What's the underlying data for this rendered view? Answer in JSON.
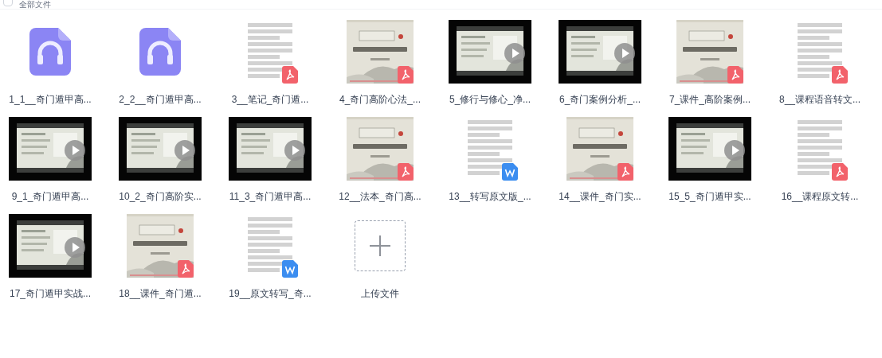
{
  "header": {
    "title": "全部文件",
    "checked": false
  },
  "files": [
    {
      "name": "1_1__奇门遁甲高...",
      "kind": "audio"
    },
    {
      "name": "2_2__奇门遁甲高...",
      "kind": "audio"
    },
    {
      "name": "3__笔记_奇门遁...",
      "kind": "pdf-page"
    },
    {
      "name": "4_奇门高阶心法_...",
      "kind": "pdf-slide"
    },
    {
      "name": "5_修行与修心_净...",
      "kind": "video"
    },
    {
      "name": "6_奇门案例分析_...",
      "kind": "video"
    },
    {
      "name": "7_课件_高阶案例...",
      "kind": "pdf-slide"
    },
    {
      "name": "8__课程语音转文...",
      "kind": "pdf-page"
    },
    {
      "name": "9_1_奇门遁甲高...",
      "kind": "video"
    },
    {
      "name": "10_2_奇门高阶实...",
      "kind": "video"
    },
    {
      "name": "11_3_奇门遁甲高...",
      "kind": "video"
    },
    {
      "name": "12__法本_奇门高...",
      "kind": "pdf-slide"
    },
    {
      "name": "13__转写原文版_...",
      "kind": "word"
    },
    {
      "name": "14__课件_奇门实...",
      "kind": "pdf-slide"
    },
    {
      "name": "15_5_奇门遁甲实...",
      "kind": "video"
    },
    {
      "name": "16__课程原文转...",
      "kind": "pdf-page"
    },
    {
      "name": "17_奇门遁甲实战...",
      "kind": "video"
    },
    {
      "name": "18__课件_奇门遁...",
      "kind": "pdf-slide"
    },
    {
      "name": "19__原文转写_奇...",
      "kind": "word"
    },
    {
      "name": "上传文件",
      "kind": "upload"
    }
  ]
}
